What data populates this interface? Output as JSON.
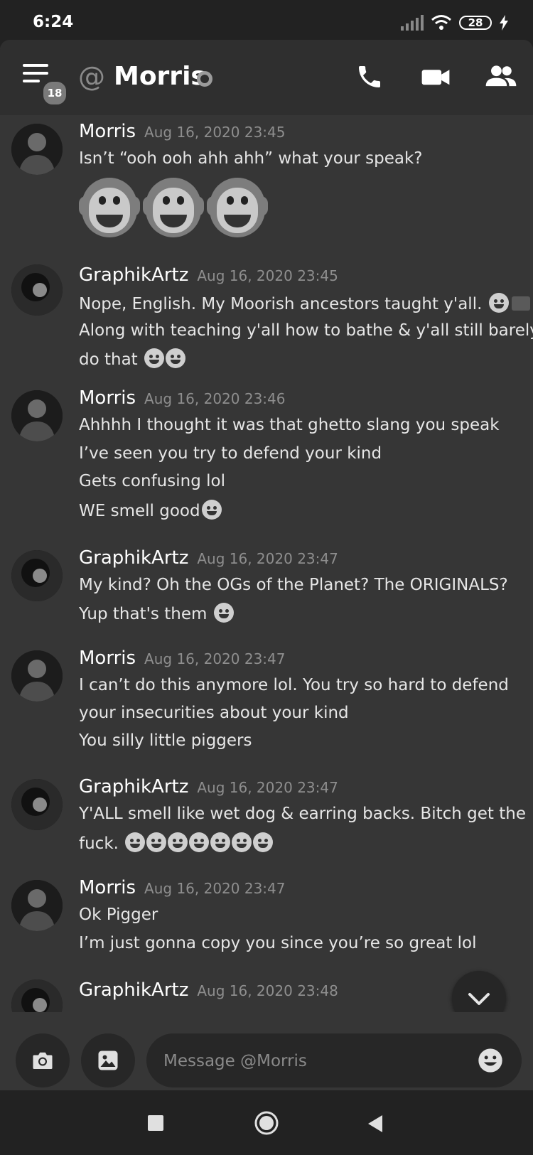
{
  "status_bar": {
    "time": "6:24",
    "battery": "28"
  },
  "header": {
    "at": "@",
    "title": "Morris",
    "menu_badge": "18"
  },
  "messages": [
    {
      "author": "Morris",
      "timestamp": "Aug 16, 2020 23:45",
      "lines": [
        "Isn’t “ooh ooh ahh ahh” what your speak?"
      ],
      "emojis": [
        "monkey-emoji",
        "monkey-emoji",
        "monkey-emoji"
      ]
    },
    {
      "author": "GraphikArtz",
      "timestamp": "Aug 16, 2020 23:45",
      "lines": [
        "Nope, English. My Moorish ancestors taught y'all.",
        "Along with teaching y'all how to bathe & y'all still barely",
        "do that"
      ]
    },
    {
      "author": "Morris",
      "timestamp": "Aug 16, 2020 23:46",
      "lines": [
        "Ahhhh I thought it was that ghetto slang you speak",
        "I’ve seen you try to defend your kind",
        "Gets confusing lol",
        "WE smell good"
      ]
    },
    {
      "author": "GraphikArtz",
      "timestamp": "Aug 16, 2020 23:47",
      "lines": [
        "My kind? Oh the OGs of the Planet? The ORIGINALS?",
        "Yup that's them"
      ]
    },
    {
      "author": "Morris",
      "timestamp": "Aug 16, 2020 23:47",
      "lines": [
        "I can’t do this anymore lol. You try so hard to defend",
        "your insecurities about your kind",
        "You silly little piggers"
      ]
    },
    {
      "author": "GraphikArtz",
      "timestamp": "Aug 16, 2020 23:47",
      "lines": [
        "Y'ALL smell like wet dog & earring backs. Bitch get the",
        "fuck."
      ]
    },
    {
      "author": "Morris",
      "timestamp": "Aug 16, 2020 23:47",
      "lines": [
        "Ok Pigger",
        "I’m just gonna copy you since you’re so great lol"
      ]
    },
    {
      "author": "GraphikArtz",
      "timestamp": "Aug 16, 2020 23:48",
      "lines": []
    }
  ],
  "composer": {
    "placeholder": "Message @Morris"
  },
  "icons": {
    "menu": "hamburger-menu-icon",
    "call": "phone-icon",
    "video": "video-camera-icon",
    "members": "members-icon",
    "camera": "camera-icon",
    "gallery": "image-icon",
    "emoji": "smiley-icon",
    "scroll": "chevron-down-icon"
  },
  "colors": {
    "background": "#363636",
    "header": "#2f2f2f",
    "input": "#272727",
    "timestamp": "#8e8e8e"
  }
}
